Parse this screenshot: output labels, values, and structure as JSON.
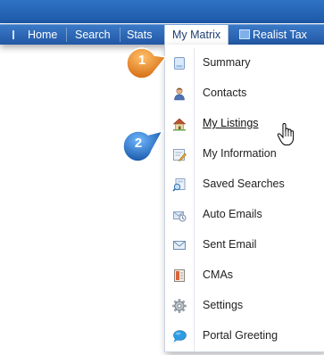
{
  "nav": {
    "items": [
      {
        "label": "Home"
      },
      {
        "label": "Search"
      },
      {
        "label": "Stats"
      },
      {
        "label": "My Matrix"
      },
      {
        "label": "Realist Tax"
      }
    ],
    "active_index": 3
  },
  "menu": {
    "items": [
      {
        "label": "Summary",
        "icon": "document-icon"
      },
      {
        "label": "Contacts",
        "icon": "person-icon"
      },
      {
        "label": "My Listings",
        "icon": "house-icon",
        "hovered": true
      },
      {
        "label": "My Information",
        "icon": "edit-form-icon"
      },
      {
        "label": "Saved Searches",
        "icon": "saved-search-icon"
      },
      {
        "label": "Auto Emails",
        "icon": "auto-email-icon"
      },
      {
        "label": "Sent Email",
        "icon": "envelope-icon"
      },
      {
        "label": "CMAs",
        "icon": "report-icon"
      },
      {
        "label": "Settings",
        "icon": "gear-icon"
      },
      {
        "label": "Portal Greeting",
        "icon": "speech-bubble-icon"
      }
    ]
  },
  "callouts": [
    {
      "number": "1",
      "color": "#e8862a"
    },
    {
      "number": "2",
      "color": "#1f6fc6"
    }
  ],
  "colors": {
    "nav_bar": "#2a66b6",
    "menu_border": "#c9d4e3",
    "callout_orange": "#e8862a",
    "callout_blue": "#1f6fc6"
  }
}
